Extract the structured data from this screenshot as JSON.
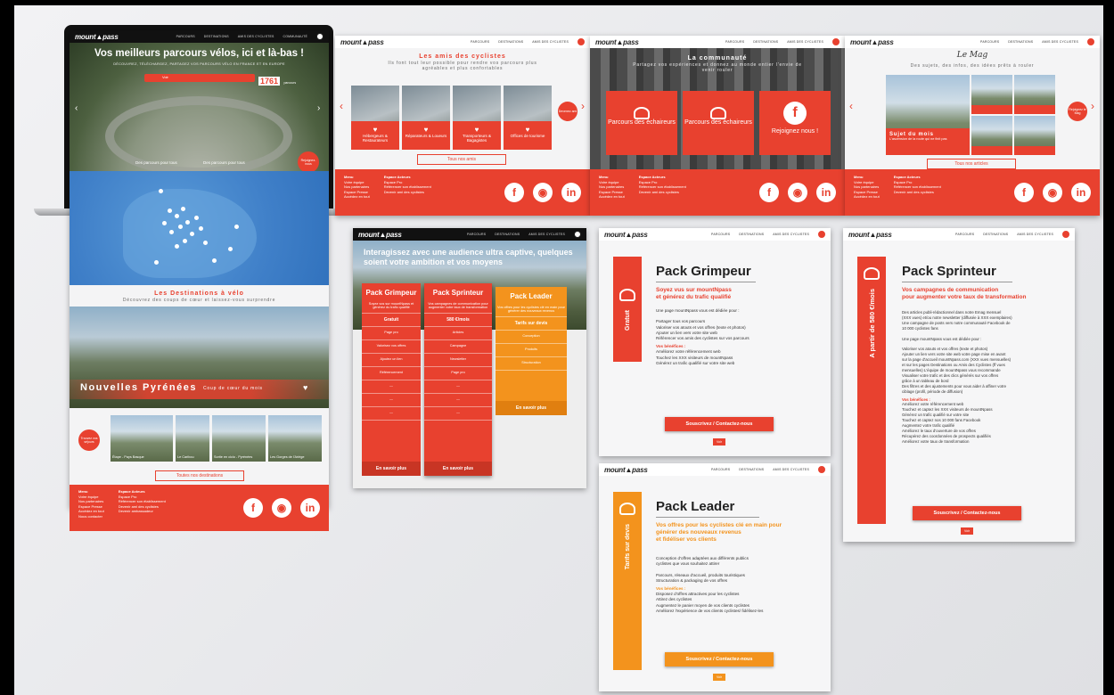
{
  "brand": {
    "logo": "mount▲pass",
    "red": "#e8412f",
    "orange": "#f3931d"
  },
  "nav": {
    "items": [
      "PARCOURS",
      "DESTINATIONS",
      "AMIS DES CYCLISTES",
      "COMMUNAUTÉ",
      "ÉVÉNEMENTS",
      "OFFRES"
    ]
  },
  "home": {
    "hero_title": "Vos meilleurs parcours vélos, ici et là-bas !",
    "hero_sub": "DÉCOUVREZ, TÉLÉCHARGEZ, PARTAGEZ VOS PARCOURS VÉLO EN FRANCE ET EN EUROPE",
    "search_btn": "Voir",
    "count": "1761",
    "count_label": "parcours",
    "badge": "Rejoignez-nous",
    "caption_left": "Des parcours pour tous",
    "caption_right": "Des parcours pour tous",
    "dest_title": "Les Destinations à vélo",
    "dest_sub": "Découvrez des coups de cœur et laissez-vous surprendre",
    "region": "Nouvelles Pyrénées",
    "region_sub": "Coup de cœur du mois",
    "thumbs": [
      "Étape - Pays Basque",
      "Le Caribou",
      "Sortie en ciclo - Pyrénées",
      "Les Gorges de l'Ariège"
    ],
    "more": "Toutes nos destinations",
    "bubble": "Trouvez vos séjours"
  },
  "footer": {
    "col1": [
      "Menu",
      "Votre équipe",
      "Nos partenaires",
      "Espace Presse",
      "Accédez en tout",
      "Nous contacter",
      "Newsletter"
    ],
    "col2": [
      "Espace Acteurs",
      "Espace Pro",
      "Référencer son établissement",
      "Devenir ami des cyclistes",
      "Devenir ambassadeur"
    ]
  },
  "amis": {
    "title": "Les amis des cyclistes",
    "sub": "Ils font tout leur possible pour rendre vos parcours plus agréables et plus confortables",
    "tiles": [
      "Hébergeurs & Restaurateurs",
      "Réparateurs & Loueurs",
      "Transporteurs & Bagagistes",
      "Offices de tourisme"
    ],
    "btn": "Tous nos amis",
    "bubble": "Devenez ami"
  },
  "communaute": {
    "title": "La communauté",
    "sub": "Partagez vos expériences et donnez au monde entier l'envie de venir rouler",
    "tiles": [
      "Parcours des échaireurs",
      "Parcours des échaireurs",
      "Rejoignez nous !"
    ]
  },
  "mag": {
    "script": "Le Mag",
    "sub": "Des sujets, des infos, des idées prêts à rouler",
    "featured": "Sujet du mois",
    "featured_sub": "L'ascension de la route qui ne finit pas",
    "btn": "Tous nos articles",
    "bubble": "Rejoignez le Mag"
  },
  "offers": {
    "headline": "Interagissez avec une audience ultra captive, quelques soient votre ambition et vos moyens",
    "cards": [
      {
        "name": "Pack Grimpeur",
        "desc": "Soyez vus sur mountNpass et générez du trafic qualifié",
        "price": "Gratuit",
        "rows": [
          "Page pro",
          "Valorisez vos offres",
          "Ajoutez un lien",
          "Référencement"
        ],
        "cta": "En savoir plus"
      },
      {
        "name": "Pack Sprinteur",
        "desc": "Vos campagnes de communication pour augmenter votre taux de transformation",
        "price": "580 €/mois",
        "rows": [
          "Articles",
          "Campagne",
          "Newsletter",
          "Page pro"
        ],
        "cta": "En savoir plus"
      },
      {
        "name": "Pack Leader",
        "desc": "Vos offres pour les cyclistes clé en main pour générer des nouveaux revenus",
        "price": "Tarifs sur devis",
        "rows": [
          "Conception",
          "Produits",
          "Structuration"
        ],
        "cta": "En savoir plus"
      }
    ]
  },
  "grimpeur": {
    "title": "Pack Grimpeur",
    "side": "Gratuit",
    "sub": "Soyez vus sur mountNpass\net générez du trafic qualifié",
    "body": [
      "Une page mountNpass vous est dédiée pour :",
      "",
      "Partager tous vos parcours",
      "Valoriser vos atouts et vos offres (texte et photos)",
      "Ajouter un lien vers votre site web",
      "Référencer vos amis des cyclistes sur vos parcours"
    ],
    "benef": "Vos bénéfices :",
    "benefits": [
      "Améliorez votre référencement web",
      "Touchez les XXX visiteurs de mountNpass",
      "Générez un trafic qualifié sur votre site web"
    ],
    "btn": "Souscrivez / Contactez-nous",
    "small": "Voir"
  },
  "sprinteur": {
    "title": "Pack Sprinteur",
    "side": "A partir de 580 €/mois",
    "sub": "Vos campagnes de communication\npour augmenter votre taux de transformation",
    "body": [
      "Des articles publi-rédactionnel dans notre Emag mensuel",
      "(XXX vues) et/ou notre newsletter (diffusée à XXX exemplaires)",
      "Une campagne de posts vers notre communauté Facebook de",
      "10 000 cyclistes fans",
      "",
      "Une page mountNpass vous est dédiée pour :",
      "",
      "Valoriser vos atouts et vos offres (texte et photos)",
      "Ajouter un lien vers votre site web votre page mise en avant",
      "sur la page d'accueil mountNpass.com (XXX vues mensuelles)",
      "et sur les pages Destinations ou Amis des Cyclistes (ff vues",
      "mensuelles) L'équipe de mountNpass vous recommande",
      "Visualiser votre trafic et des clics générés sur vos offres",
      "grâce à un tableau de bord",
      "Des filtres et des ajustements pour vous aider à affiner votre",
      "ciblage (profil, période de diffusion)"
    ],
    "benef": "Vos bénéfices :",
    "benefits": [
      "Améliorez votre référencement web",
      "Touchez et captez les XXX visiteurs de mountNpass",
      "Générez un trafic qualifié sur votre site",
      "Touchez et captez nos 10 000 fans Facebook",
      "Augmentez votre trafic qualifié",
      "Améliorez le taux d'ouverture de vos offres",
      "Récupérez des coordonnées de prospects qualifiés",
      "Améliorez votre taux de transformation"
    ],
    "btn": "Souscrivez / Contactez-nous",
    "small": "Voir"
  },
  "leader": {
    "title": "Pack Leader",
    "side": "Tarifs sur devis",
    "sub": "Vos offres pour les cyclistes clé en main pour\ngénérer des nouveaux revenus\net fidéliser vos clients",
    "body": [
      "Conception d'offres adaptées aux différents publics",
      "cyclistes que vous souhaitez attirer",
      "",
      "Parcours, réseaux d'accueil, produits touristiques",
      "Structuration & packaging de vos offres"
    ],
    "benef": "Vos bénéfices :",
    "benefits": [
      "Disposez d'offres attractives pour les cyclistes",
      "Attirez des cyclistes",
      "Augmentez le panier moyen de vos clients cyclistes",
      "Améliorez l'expérience de vos clients cyclistes/ fidélisez-les"
    ],
    "btn": "Souscrivez / Contactez-nous",
    "small": "Voir"
  }
}
